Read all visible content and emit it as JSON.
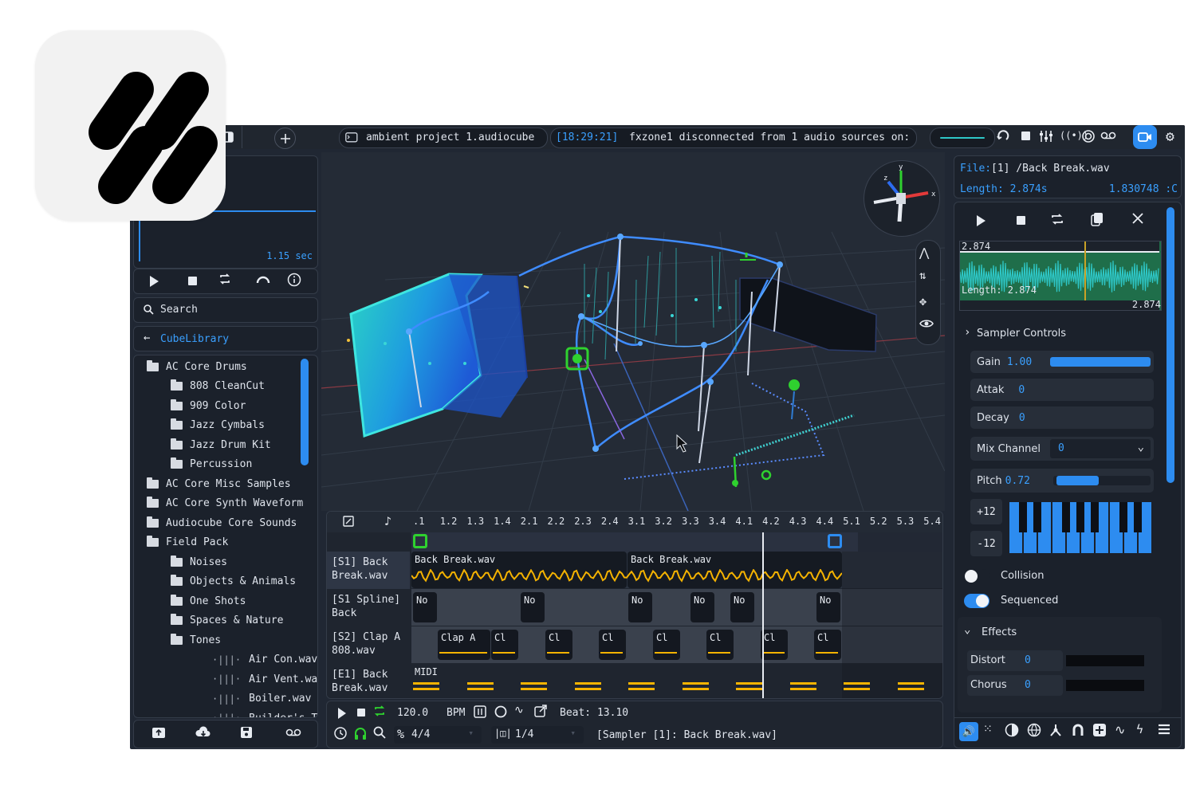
{
  "app": {
    "project_file": "ambient project 1.audiocube",
    "status_time": "[18:29:21]",
    "status_message": "fxzone1 disconnected from 1 audio sources on:"
  },
  "left_panel": {
    "duration": "1.15 sec",
    "search_placeholder": "Search",
    "library_title": "CubeLibrary",
    "tree": [
      {
        "label": "AC Core Drums",
        "type": "folder-open",
        "depth": 0
      },
      {
        "label": "808 CleanCut",
        "type": "folder",
        "depth": 1
      },
      {
        "label": "909 Color",
        "type": "folder",
        "depth": 1
      },
      {
        "label": "Jazz Cymbals",
        "type": "folder",
        "depth": 1
      },
      {
        "label": "Jazz Drum Kit",
        "type": "folder",
        "depth": 1
      },
      {
        "label": "Percussion",
        "type": "folder",
        "depth": 1
      },
      {
        "label": "AC Core Misc Samples",
        "type": "folder",
        "depth": 0
      },
      {
        "label": "AC Core Synth Waveform",
        "type": "folder",
        "depth": 0
      },
      {
        "label": "Audiocube Core Sounds",
        "type": "folder",
        "depth": 0
      },
      {
        "label": "Field Pack",
        "type": "folder-open",
        "depth": 0
      },
      {
        "label": "Noises",
        "type": "folder",
        "depth": 1
      },
      {
        "label": "Objects & Animals",
        "type": "folder",
        "depth": 1
      },
      {
        "label": "One Shots",
        "type": "folder",
        "depth": 1
      },
      {
        "label": "Spaces & Nature",
        "type": "folder",
        "depth": 1
      },
      {
        "label": "Tones",
        "type": "folder-open",
        "depth": 1
      },
      {
        "label": "Air Con.wav",
        "type": "wav",
        "depth": 2
      },
      {
        "label": "Air Vent.wav",
        "type": "wav",
        "depth": 2
      },
      {
        "label": "Boiler.wav",
        "type": "wav",
        "depth": 2
      },
      {
        "label": "Builder's Truck",
        "type": "wav",
        "depth": 2
      }
    ]
  },
  "timeline": {
    "ruler": [
      ".1",
      "1.2",
      "1.3",
      "1.4",
      "2.1",
      "2.2",
      "2.3",
      "2.4",
      "3.1",
      "3.2",
      "3.3",
      "3.4",
      "4.1",
      "4.2",
      "4.3",
      "4.4",
      "5.1",
      "5.2",
      "5.3",
      "5.4"
    ],
    "tracks": [
      {
        "label": "[S1] Back Break.wav"
      },
      {
        "label": "[S1 Spline] Back"
      },
      {
        "label": "[S2] Clap A 808.wav"
      },
      {
        "label": "[E1] Back Break.wav"
      }
    ],
    "sample_clips": [
      "Back Break.wav",
      "Back Break.wav"
    ],
    "spline_clips": [
      "No",
      "No",
      "No",
      "No",
      "No",
      "No"
    ],
    "clap_clips": [
      "Clap A",
      "Cl",
      "Cl",
      "Cl",
      "Cl",
      "Cl",
      "Cl",
      "Cl"
    ],
    "midi_label": "MIDI",
    "bpm_value": "120.0",
    "bpm_label": "BPM",
    "beat_label": "Beat: 13.10",
    "time_signature": "4/4",
    "quantize": "1/4",
    "selection_status": "[Sampler [1]: Back Break.wav]"
  },
  "right_panel": {
    "file_label": "File:",
    "file_name": "[1] /Back Break.wav",
    "length_label": "Length: 2.874s",
    "length_right": "1.830748 :C",
    "waveform_top": "2.874",
    "waveform_length": "Length: 2.874",
    "waveform_end": "2.874",
    "sampler_title": "Sampler Controls",
    "gain_label": "Gain",
    "gain_value": "1.00",
    "gain_level": 1.0,
    "attack_label": "Attak",
    "attack_value": "0",
    "decay_label": "Decay",
    "decay_value": "0",
    "mix_label": "Mix Channel",
    "mix_value": "0",
    "pitch_label": "Pitch",
    "pitch_value": "0.72",
    "pitch_level": 0.45,
    "octave_up": "+12",
    "octave_down": "-12",
    "collision_label": "Collision",
    "collision_on": false,
    "sequenced_label": "Sequenced",
    "sequenced_on": true,
    "effects_title": "Effects",
    "distort_label": "Distort",
    "distort_value": "0",
    "chorus_label": "Chorus",
    "chorus_value": "0"
  },
  "colors": {
    "accent": "#2d8cf0",
    "clip_yellow": "#f5b301",
    "green": "#2fd12f",
    "background": "#202733"
  }
}
